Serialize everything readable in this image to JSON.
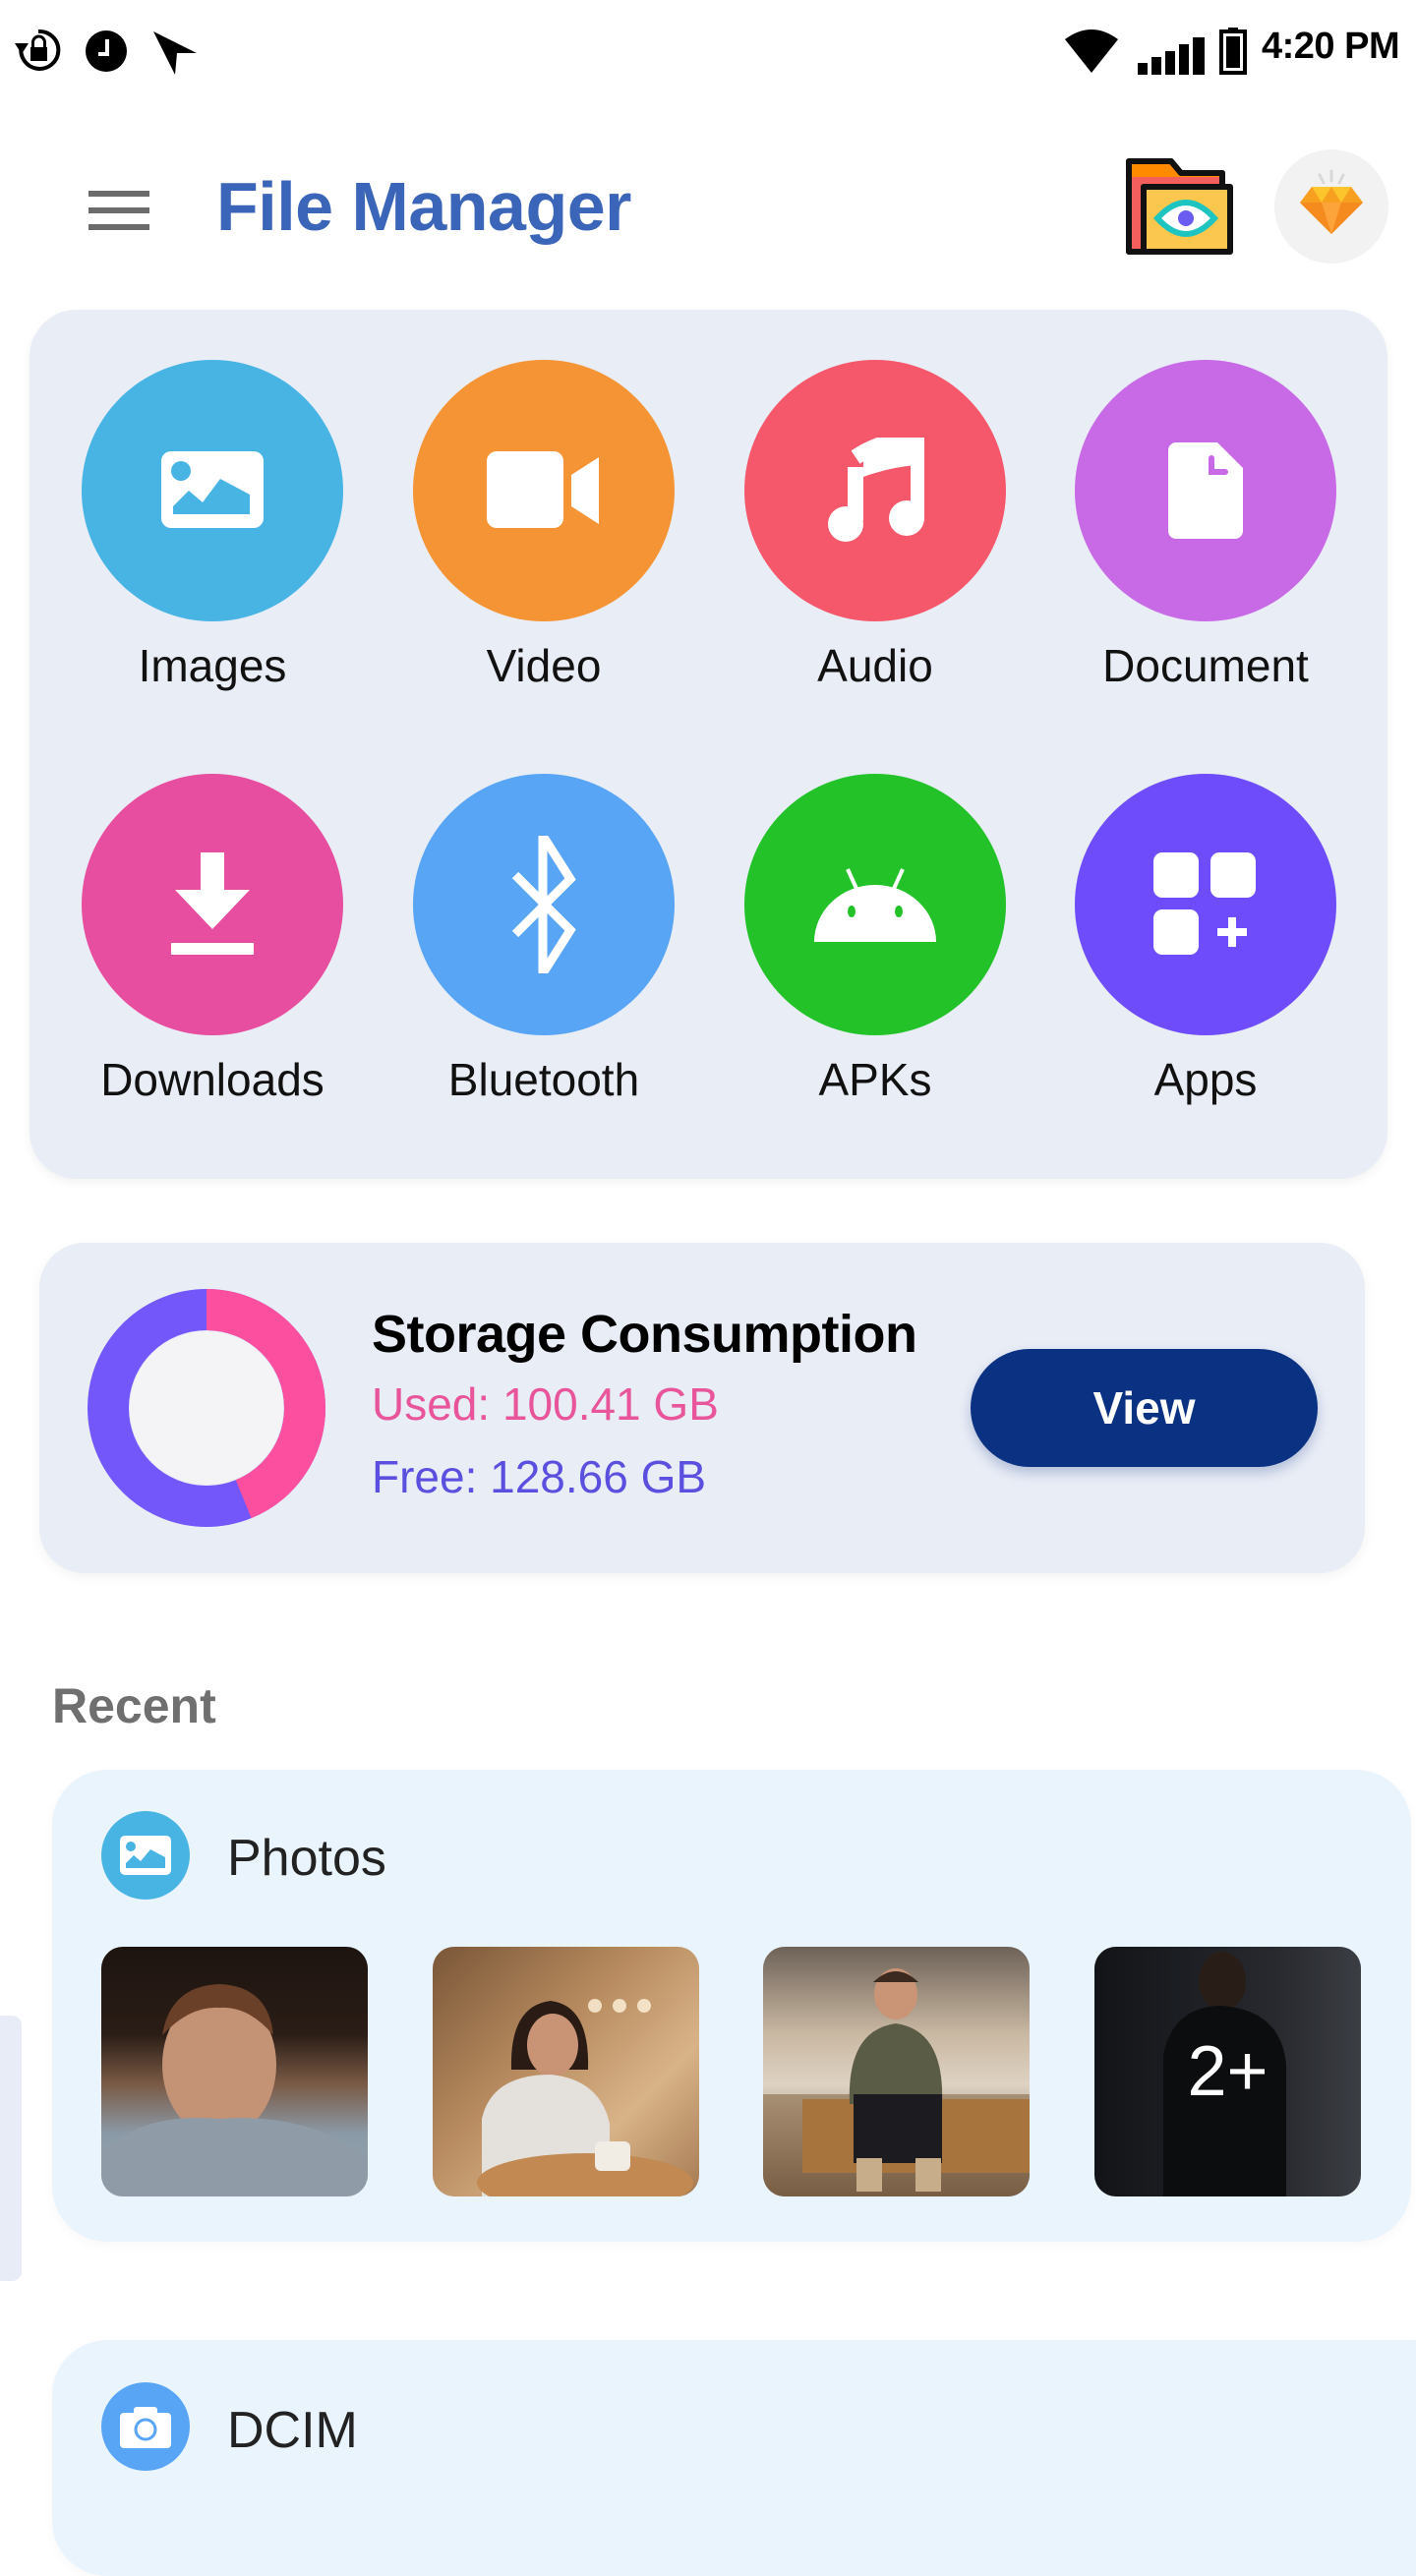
{
  "status_bar": {
    "left_icons": [
      "screen-rotation-lock-icon",
      "alarm-clock-icon",
      "location-arrow-icon"
    ],
    "right_icons": [
      "wifi-icon",
      "cellular-signal-icon",
      "battery-icon"
    ],
    "time": "4:20 PM"
  },
  "header": {
    "menu_icon": "hamburger-menu-icon",
    "title": "File Manager",
    "actions": [
      "hidden-folder-eye-icon",
      "premium-diamond-icon"
    ],
    "title_color": "#3b65b8"
  },
  "categories": [
    {
      "label": "Images",
      "icon": "image-icon",
      "color": "#48b4e4"
    },
    {
      "label": "Video",
      "icon": "video-camera-icon",
      "color": "#f59435"
    },
    {
      "label": "Audio",
      "icon": "music-note-icon",
      "color": "#f5586b"
    },
    {
      "label": "Document",
      "icon": "document-icon",
      "color": "#c86ae6"
    },
    {
      "label": "Downloads",
      "icon": "download-icon",
      "color": "#e84e9f"
    },
    {
      "label": "Bluetooth",
      "icon": "bluetooth-icon",
      "color": "#58a5f5"
    },
    {
      "label": "APKs",
      "icon": "android-icon",
      "color": "#22c228"
    },
    {
      "label": "Apps",
      "icon": "apps-grid-icon",
      "color": "#6e4cfb"
    }
  ],
  "storage": {
    "title": "Storage Consumption",
    "used_label": "Used: 100.41 GB",
    "free_label": "Free: 128.66 GB",
    "used_gb": 100.41,
    "free_gb": 128.66,
    "used_color": "#fd4f9f",
    "free_color": "#7457fb",
    "view_button": "View"
  },
  "recent": {
    "label": "Recent",
    "folders": [
      {
        "name": "Photos",
        "icon": "image-icon",
        "icon_color": "#48b4e4",
        "thumbnails": [
          {
            "alt": "Man in grey t-shirt portrait"
          },
          {
            "alt": "Woman writing at cafe table"
          },
          {
            "alt": "Man sitting on wooden bench"
          },
          {
            "alt": "Man in leather jacket",
            "overlay": "2+"
          }
        ]
      },
      {
        "name": "DCIM",
        "icon": "camera-icon",
        "icon_color": "#58a5f5"
      }
    ]
  }
}
